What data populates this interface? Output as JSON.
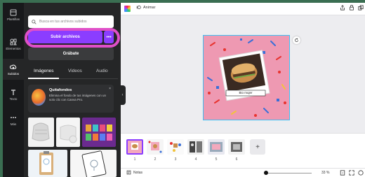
{
  "rail": {
    "items": [
      {
        "label": "Plantillas",
        "icon": "templates-icon"
      },
      {
        "label": "Elementos",
        "icon": "elements-icon"
      },
      {
        "label": "Subidos",
        "icon": "uploads-icon"
      },
      {
        "label": "Texto",
        "icon": "text-icon"
      },
      {
        "label": "Más",
        "icon": "more-icon"
      }
    ]
  },
  "panel": {
    "search_placeholder": "Busca en tus archivos subidos",
    "upload_label": "Subir archivos",
    "more_label": "•••",
    "record_label": "Grábate",
    "tabs": [
      {
        "label": "Imágenes"
      },
      {
        "label": "Videos"
      },
      {
        "label": "Audio"
      }
    ],
    "promo": {
      "title": "Quitafondos",
      "text": "Elimina el fondo de tus imágenes con un solo clic con Canva Pro.",
      "close": "×"
    }
  },
  "topbar": {
    "animate_label": "Animar"
  },
  "canvas": {
    "caption": "Bio mujer"
  },
  "timeline": {
    "pages": [
      "1",
      "2",
      "3",
      "4",
      "5",
      "6"
    ],
    "add_label": "+"
  },
  "bottombar": {
    "notes_label": "Notas",
    "zoom": "33 %",
    "zoom_level": 0.33,
    "page_count": "7"
  },
  "colors": {
    "accent": "#8b3dff",
    "annotation": "#e04fc8",
    "canvas_pink": "#ee99b2",
    "selection": "#3fbff2",
    "sidebar": "#252627",
    "rail": "#18191b"
  }
}
